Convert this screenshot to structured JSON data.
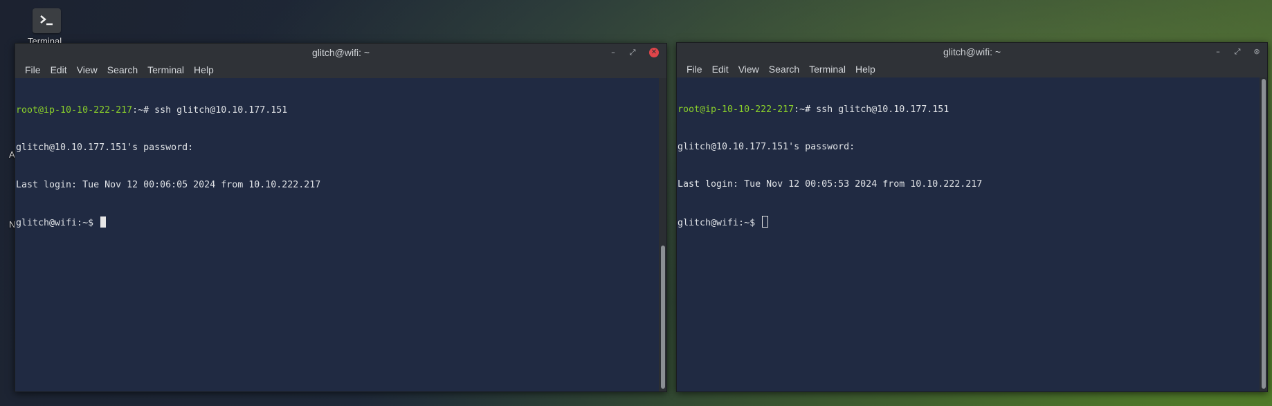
{
  "desktop": {
    "terminal_icon_label": "Terminal",
    "fragment_a": "A",
    "fragment_n": "N"
  },
  "windows": [
    {
      "title": "glitch@wifi: ~",
      "menu": [
        "File",
        "Edit",
        "View",
        "Search",
        "Terminal",
        "Help"
      ],
      "lines": {
        "prompt_user": "root@ip-10-10-222-217",
        "prompt_rest": ":~# ssh glitch@10.10.177.151",
        "password": "glitch@10.10.177.151's password:",
        "last_login": "Last login: Tue Nov 12 00:06:05 2024 from 10.10.222.217",
        "shell_prompt": "glitch@wifi:~$ "
      },
      "focused": true
    },
    {
      "title": "glitch@wifi: ~",
      "menu": [
        "File",
        "Edit",
        "View",
        "Search",
        "Terminal",
        "Help"
      ],
      "lines": {
        "prompt_user": "root@ip-10-10-222-217",
        "prompt_rest": ":~# ssh glitch@10.10.177.151",
        "password": "glitch@10.10.177.151's password:",
        "last_login": "Last login: Tue Nov 12 00:05:53 2024 from 10.10.222.217",
        "shell_prompt": "glitch@wifi:~$ "
      },
      "focused": false
    }
  ],
  "icons": {
    "window_minimize": "minimize-icon",
    "window_maximize": "maximize-icon",
    "window_close": "close-icon",
    "desktop_terminal": "terminal-icon"
  },
  "colors": {
    "terminal_bg": "#202a42",
    "prompt_green": "#8bd12a",
    "close_red": "#e0454a"
  }
}
